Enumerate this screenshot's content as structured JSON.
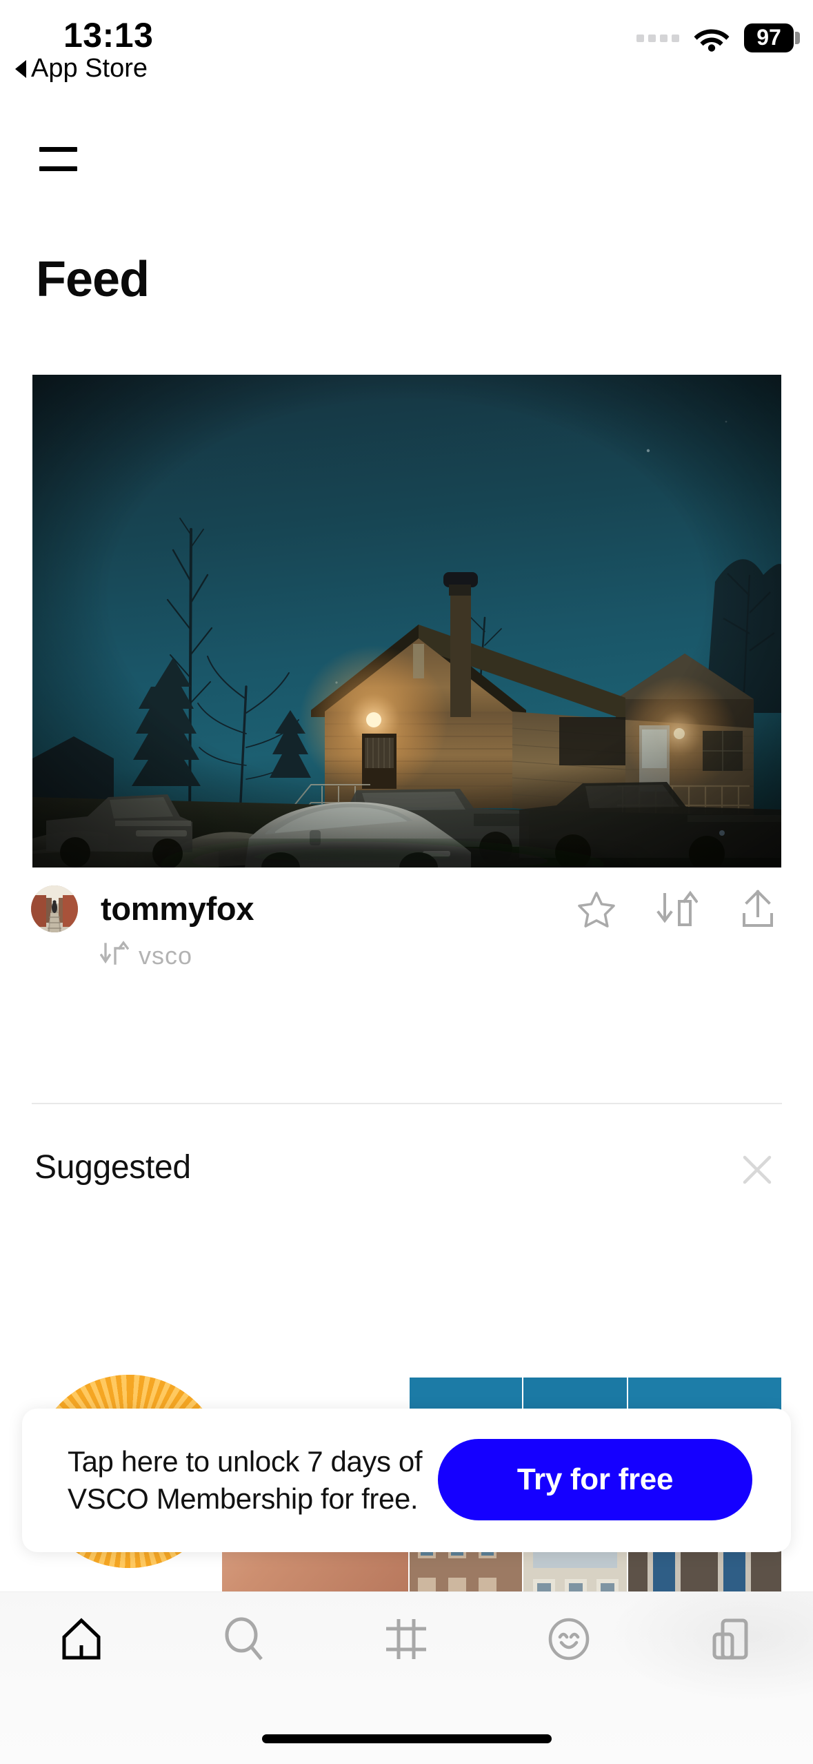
{
  "status_bar": {
    "time": "13:13",
    "back_label": "App Store",
    "back_icon": "triangle-left-icon",
    "signal_icon": "cellular-dots-icon",
    "wifi_icon": "wifi-icon",
    "battery_level": "97"
  },
  "header": {
    "menu_icon": "hamburger-menu-icon",
    "title": "Feed"
  },
  "post": {
    "image_alt": "night photo of a house with porch light, parked trucks and snow",
    "username": "tommyfox",
    "avatar_alt": "railroad tracks with person walking",
    "repost_icon": "repost-icon",
    "repost_source": "vsco",
    "actions": [
      {
        "name": "favorite-button",
        "icon": "star-icon"
      },
      {
        "name": "repost-button",
        "icon": "repost-icon"
      },
      {
        "name": "share-button",
        "icon": "share-upload-icon"
      }
    ]
  },
  "suggested": {
    "title": "Suggested",
    "close_icon": "close-x-icon",
    "tiles": [
      {
        "name": "suggested-avatar",
        "alt": "orange radial sunburst avatar"
      },
      {
        "name": "suggested-tile-1",
        "alt": "close-up of skin and jewelry"
      },
      {
        "name": "suggested-tile-2",
        "alt": "blue sky over building facade"
      },
      {
        "name": "suggested-tile-3",
        "alt": "blue sky over light building facade"
      },
      {
        "name": "suggested-tile-4",
        "alt": "blue sky over dark roof with windows"
      }
    ]
  },
  "promo": {
    "line1": "Tap here to unlock 7 days of",
    "line2": "VSCO Membership for free.",
    "button_label": "Try for free",
    "button_color": "#1500ff"
  },
  "tabbar": {
    "items": [
      {
        "name": "tab-home",
        "icon": "home-icon",
        "label": "Home",
        "active": true
      },
      {
        "name": "tab-search",
        "icon": "search-icon",
        "label": "Search",
        "active": false
      },
      {
        "name": "tab-studio",
        "icon": "crop-frame-icon",
        "label": "Studio",
        "active": false
      },
      {
        "name": "tab-profile",
        "icon": "smiley-icon",
        "label": "Profile",
        "active": false
      },
      {
        "name": "tab-spaces",
        "icon": "spaces-bars-icon",
        "label": "Spaces",
        "active": false
      }
    ],
    "home_indicator": "home-indicator"
  },
  "colors": {
    "accent_blue": "#1500ff",
    "icon_gray": "#aaaaaa",
    "text_black": "#0b0b0b",
    "muted_gray": "#b3b3b3"
  }
}
